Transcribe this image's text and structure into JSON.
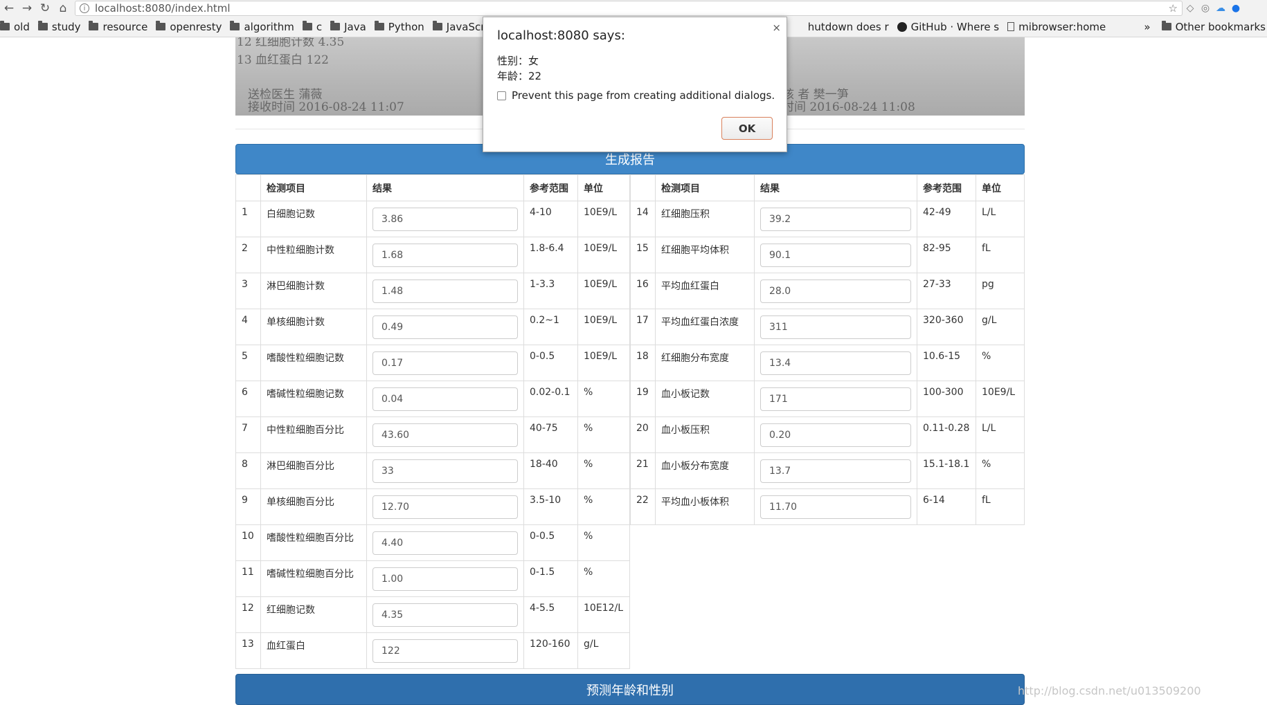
{
  "browser": {
    "url": "localhost:8080/index.html",
    "bookmarks": [
      "old",
      "study",
      "resource",
      "openresty",
      "algorithm",
      "c",
      "Java",
      "Python",
      "JavaScrip",
      "hutdown does r",
      "GitHub · Where s",
      "mibrowser:home"
    ],
    "overflow": "»",
    "other_bookmarks": "Other bookmarks"
  },
  "scan": {
    "line1": "12 红细胞计数            4.35",
    "line2": "13 血红蛋白              122",
    "line3": "送检医生 蒲薇",
    "line4": "接收时间 2016-08-24 11:07",
    "line5": "核 者 樊一笋",
    "line6": "时间 2016-08-24 11:08"
  },
  "generate_button": "生成报告",
  "table_headers": {
    "item": "检测项目",
    "result": "结果",
    "range": "参考范围",
    "unit": "单位"
  },
  "left_rows": [
    {
      "no": "1",
      "name": "白细胞记数",
      "value": "3.86",
      "range": "4-10",
      "unit": "10E9/L"
    },
    {
      "no": "2",
      "name": "中性粒细胞计数",
      "value": "1.68",
      "range": "1.8-6.4",
      "unit": "10E9/L"
    },
    {
      "no": "3",
      "name": "淋巴细胞计数",
      "value": "1.48",
      "range": "1-3.3",
      "unit": "10E9/L"
    },
    {
      "no": "4",
      "name": "单核细胞计数",
      "value": "0.49",
      "range": "0.2~1",
      "unit": "10E9/L"
    },
    {
      "no": "5",
      "name": "嗜酸性粒细胞记数",
      "value": "0.17",
      "range": "0-0.5",
      "unit": "10E9/L"
    },
    {
      "no": "6",
      "name": "嗜碱性粒细胞记数",
      "value": "0.04",
      "range": "0.02-0.1",
      "unit": "%"
    },
    {
      "no": "7",
      "name": "中性粒细胞百分比",
      "value": "43.60",
      "range": "40-75",
      "unit": "%"
    },
    {
      "no": "8",
      "name": "淋巴细胞百分比",
      "value": "33",
      "range": "18-40",
      "unit": "%"
    },
    {
      "no": "9",
      "name": "单核细胞百分比",
      "value": "12.70",
      "range": "3.5-10",
      "unit": "%"
    },
    {
      "no": "10",
      "name": "嗜酸性粒细胞百分比",
      "value": "4.40",
      "range": "0-0.5",
      "unit": "%"
    },
    {
      "no": "11",
      "name": "嗜碱性粒细胞百分比",
      "value": "1.00",
      "range": "0-1.5",
      "unit": "%"
    },
    {
      "no": "12",
      "name": "红细胞记数",
      "value": "4.35",
      "range": "4-5.5",
      "unit": "10E12/L"
    },
    {
      "no": "13",
      "name": "血红蛋白",
      "value": "122",
      "range": "120-160",
      "unit": "g/L"
    }
  ],
  "right_rows": [
    {
      "no": "14",
      "name": "红细胞压积",
      "value": "39.2",
      "range": "42-49",
      "unit": "L/L"
    },
    {
      "no": "15",
      "name": "红细胞平均体积",
      "value": "90.1",
      "range": "82-95",
      "unit": "fL"
    },
    {
      "no": "16",
      "name": "平均血红蛋白",
      "value": "28.0",
      "range": "27-33",
      "unit": "pg"
    },
    {
      "no": "17",
      "name": "平均血红蛋白浓度",
      "value": "311",
      "range": "320-360",
      "unit": "g/L"
    },
    {
      "no": "18",
      "name": "红细胞分布宽度",
      "value": "13.4",
      "range": "10.6-15",
      "unit": "%"
    },
    {
      "no": "19",
      "name": "血小板记数",
      "value": "171",
      "range": "100-300",
      "unit": "10E9/L"
    },
    {
      "no": "20",
      "name": "血小板压积",
      "value": "0.20",
      "range": "0.11-0.28",
      "unit": "L/L"
    },
    {
      "no": "21",
      "name": "血小板分布宽度",
      "value": "13.7",
      "range": "15.1-18.1",
      "unit": "%"
    },
    {
      "no": "22",
      "name": "平均血小板体积",
      "value": "11.70",
      "range": "6-14",
      "unit": "fL"
    }
  ],
  "predict_button": "预测年龄和性别",
  "watermark": "http://blog.csdn.net/u013509200",
  "dialog": {
    "title": "localhost:8080 says:",
    "line1": "性别：女",
    "line2": "年龄：22",
    "prevent": "Prevent this page from creating additional dialogs.",
    "ok": "OK",
    "close": "×"
  }
}
